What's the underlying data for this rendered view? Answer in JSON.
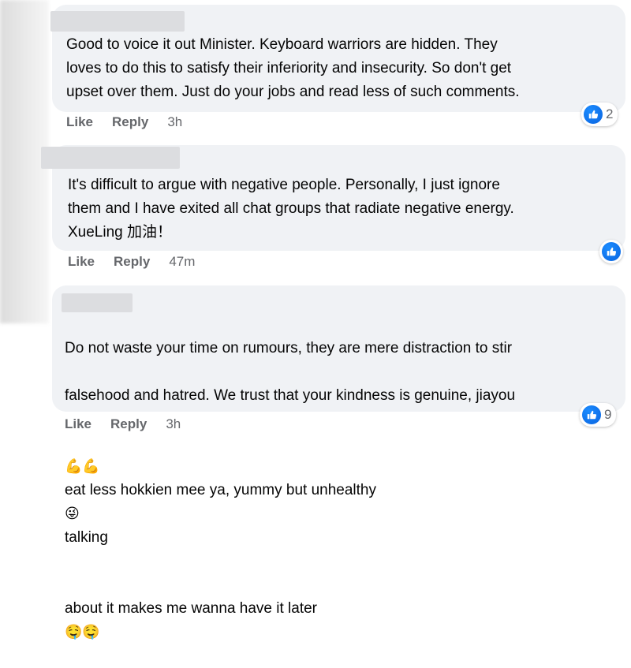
{
  "comments": [
    {
      "text": "Good to voice it out Minister. Keyboard warriors are hidden. They\nloves to do this to satisfy their inferiority and insecurity. So don't get\nupset over them. Just do your jobs and read less of such comments.",
      "like_label": "Like",
      "reply_label": "Reply",
      "time": "3h",
      "reaction_icon": "like-icon",
      "reaction_count": "2"
    },
    {
      "text": "It's difficult to argue with negative people. Personally, I just ignore\nthem and I have exited all chat groups that radiate negative energy.\nXueLing 加油！",
      "like_label": "Like",
      "reply_label": "Reply",
      "time": "47m",
      "reaction_icon": "like-icon",
      "reaction_count": ""
    },
    {
      "text_line1": "Do not waste your time on rumours, they are mere distraction to stir",
      "text_line2": "falsehood and hatred. We trust that your kindness is genuine, jiayou",
      "text_line3": "eat less hokkien mee ya, yummy but unhealthy",
      "text_line3_tail": "talking",
      "text_line4": "about it makes me wanna have it later",
      "emoji_muscle": "💪💪",
      "emoji_zany": "😜",
      "emoji_drool": "🤤🤤",
      "like_label": "Like",
      "reply_label": "Reply",
      "time": "3h",
      "reaction_icon": "like-icon",
      "reaction_count": "9"
    }
  ],
  "colors": {
    "bubble": "#f0f2f5",
    "text": "#050505",
    "meta": "#65676b",
    "like_blue": "#1877f2"
  }
}
